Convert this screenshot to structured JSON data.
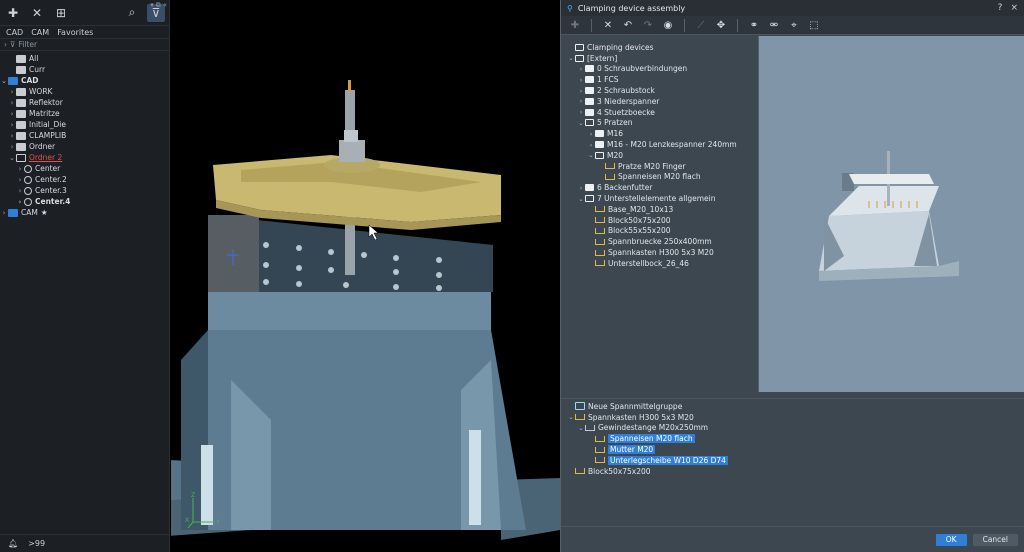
{
  "left_panel": {
    "tabs": [
      "CAD",
      "CAM",
      "Favorites"
    ],
    "filter_label": "Filter",
    "tree": [
      {
        "label": "All",
        "depth": 1,
        "icon": "folder",
        "chevron": ""
      },
      {
        "label": "Curr",
        "depth": 1,
        "icon": "folder",
        "chevron": ""
      },
      {
        "label": "CAD",
        "depth": 0,
        "icon": "cad",
        "chevron": "v",
        "bold": true
      },
      {
        "label": "WORK",
        "depth": 1,
        "icon": "folder",
        "chevron": ">"
      },
      {
        "label": "Reflektor",
        "depth": 1,
        "icon": "folder",
        "chevron": ">"
      },
      {
        "label": "Matritze",
        "depth": 1,
        "icon": "folder",
        "chevron": ">"
      },
      {
        "label": "Initial_Die",
        "depth": 1,
        "icon": "folder",
        "chevron": ">"
      },
      {
        "label": "CLAMPLIB",
        "depth": 1,
        "icon": "folder",
        "chevron": ">"
      },
      {
        "label": "Ordner",
        "depth": 1,
        "icon": "folder",
        "chevron": ">"
      },
      {
        "label": "Ordner 2",
        "depth": 1,
        "icon": "folder-open",
        "chevron": "v",
        "red": true
      },
      {
        "label": "Center",
        "depth": 2,
        "icon": "clock",
        "chevron": ">"
      },
      {
        "label": "Center.2",
        "depth": 2,
        "icon": "clock",
        "chevron": ">"
      },
      {
        "label": "Center.3",
        "depth": 2,
        "icon": "clock",
        "chevron": ">"
      },
      {
        "label": "Center.4",
        "depth": 2,
        "icon": "clock",
        "chevron": ">",
        "bold": true
      },
      {
        "label": "CAM",
        "depth": 0,
        "icon": "cad",
        "chevron": ">",
        "star": true
      }
    ],
    "status_count": ">99"
  },
  "dialog": {
    "title": "Clamping device assembly",
    "title_help": "?",
    "title_close": "×",
    "tree": [
      {
        "label": "Clamping devices",
        "depth": 0,
        "icon": "folder-open",
        "chevron": ""
      },
      {
        "label": "[Extern]",
        "depth": 0,
        "icon": "folder-open",
        "chevron": "v"
      },
      {
        "label": "0 Schraubverbindungen",
        "depth": 1,
        "icon": "folder",
        "chevron": ">"
      },
      {
        "label": "1 FCS",
        "depth": 1,
        "icon": "folder",
        "chevron": ">"
      },
      {
        "label": "2 Schraubstock",
        "depth": 1,
        "icon": "folder",
        "chevron": ">"
      },
      {
        "label": "3 Niederspanner",
        "depth": 1,
        "icon": "folder",
        "chevron": ">"
      },
      {
        "label": "4 Stuetzboecke",
        "depth": 1,
        "icon": "folder",
        "chevron": ">"
      },
      {
        "label": "5 Pratzen",
        "depth": 1,
        "icon": "folder-open",
        "chevron": "v"
      },
      {
        "label": "M16",
        "depth": 2,
        "icon": "folder",
        "chevron": ">"
      },
      {
        "label": "M16 - M20 Lenzkespanner 240mm",
        "depth": 2,
        "icon": "folder",
        "chevron": ">"
      },
      {
        "label": "M20",
        "depth": 2,
        "icon": "folder-open",
        "chevron": "v"
      },
      {
        "label": "Pratze M20 Finger",
        "depth": 3,
        "icon": "clamp",
        "chevron": ""
      },
      {
        "label": "Spanneisen M20 flach",
        "depth": 3,
        "icon": "clamp",
        "chevron": ""
      },
      {
        "label": "6 Backenfutter",
        "depth": 1,
        "icon": "folder",
        "chevron": ">"
      },
      {
        "label": "7 Unterstellelemente allgemein",
        "depth": 1,
        "icon": "folder-open",
        "chevron": "v"
      },
      {
        "label": "Base_M20_10x13",
        "depth": 2,
        "icon": "clamp",
        "chevron": ""
      },
      {
        "label": "Block50x75x200",
        "depth": 2,
        "icon": "clamp",
        "chevron": ""
      },
      {
        "label": "Block55x55x200",
        "depth": 2,
        "icon": "clamp",
        "chevron": ""
      },
      {
        "label": "Spannbruecke 250x400mm",
        "depth": 2,
        "icon": "clamp",
        "chevron": ""
      },
      {
        "label": "Spannkasten H300 5x3 M20",
        "depth": 2,
        "icon": "clamp",
        "chevron": ""
      },
      {
        "label": "Unterstellbock_26_46",
        "depth": 2,
        "icon": "clamp",
        "chevron": ""
      }
    ],
    "assembly": [
      {
        "label": "Neue Spannmittelgruppe",
        "depth": 0,
        "icon": "group",
        "chevron": ""
      },
      {
        "label": "Spannkasten H300 5x3 M20",
        "depth": 0,
        "icon": "clamp",
        "chevron": "v"
      },
      {
        "label": "Gewindestange M20x250mm",
        "depth": 1,
        "icon": "chain",
        "chevron": "v"
      },
      {
        "label": "Spanneisen M20 flach",
        "depth": 2,
        "icon": "clamp",
        "chevron": "",
        "selected": true
      },
      {
        "label": "Mutter M20",
        "depth": 2,
        "icon": "clamp",
        "chevron": "",
        "selected": true
      },
      {
        "label": "Unterlegscheibe W10 D26 D74",
        "depth": 2,
        "icon": "clamp",
        "chevron": "",
        "selected": true
      },
      {
        "label": "Block50x75x200",
        "depth": 0,
        "icon": "clamp",
        "chevron": ""
      }
    ],
    "ok_label": "OK",
    "cancel_label": "Cancel"
  },
  "viewport": {
    "axis_x": "X",
    "axis_y": "Y",
    "axis_z": "Z"
  },
  "colors": {
    "accent": "#2f7fd8",
    "dialog_bg": "#3d4750",
    "preview_bg": "#8095a8",
    "clamp_gold": "#c9b870"
  }
}
